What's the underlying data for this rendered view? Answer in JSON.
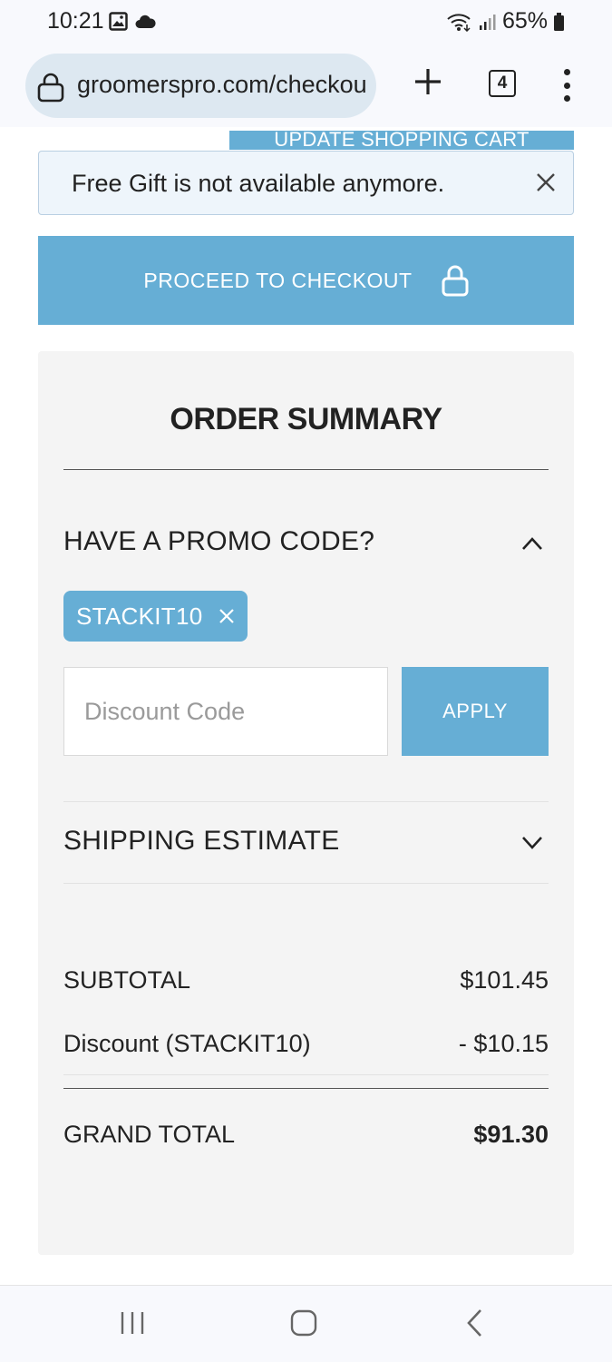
{
  "status_bar": {
    "time": "10:21",
    "battery": "65%",
    "icons": [
      "image-icon",
      "cloud-icon",
      "wifi-icon",
      "signal-icon",
      "battery-icon"
    ]
  },
  "browser": {
    "url": "groomerspro.com/checkout",
    "tab_count": "4"
  },
  "cart": {
    "update_label": "UPDATE SHOPPING CART"
  },
  "notice": {
    "text": "Free Gift is not available anymore."
  },
  "checkout": {
    "label": "PROCEED TO CHECKOUT"
  },
  "summary": {
    "title": "ORDER SUMMARY",
    "promo": {
      "title": "HAVE A PROMO CODE?",
      "applied_code": "STACKIT10",
      "input_placeholder": "Discount Code",
      "input_value": "",
      "apply_label": "APPLY"
    },
    "shipping": {
      "title": "SHIPPING ESTIMATE"
    },
    "subtotal": {
      "label": "SUBTOTAL",
      "value": "$101.45"
    },
    "discount": {
      "label": "Discount (STACKIT10)",
      "value": "- $10.15"
    },
    "grand_total": {
      "label": "GRAND TOTAL",
      "value": "$91.30"
    }
  },
  "colors": {
    "accent": "#66aed5",
    "notice_bg": "#eef5fb",
    "summary_bg": "#f4f4f4",
    "text": "#222222"
  }
}
